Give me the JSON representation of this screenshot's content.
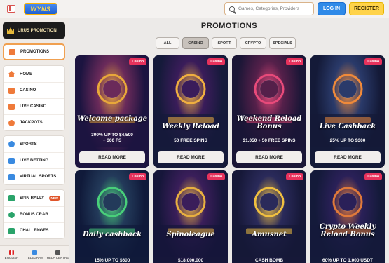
{
  "header": {
    "logo_text": "WYNS",
    "search_placeholder": "Games, Categories, Providers",
    "login_label": "LOG IN",
    "register_label": "REGISTER"
  },
  "sidebar": {
    "promo_banner": "URUS PROMOTION",
    "active_item": "PROMOTIONS",
    "group1": [
      "HOME",
      "CASINO",
      "LIVE CASINO",
      "JACKPOTS"
    ],
    "group2": [
      "SPORTS",
      "LIVE BETTING",
      "VIRTUAL SPORTS"
    ],
    "group3": [
      "SPIN RALLY",
      "BONUS CRAB",
      "CHALLENGES"
    ],
    "new_badge": "NEW",
    "footer": [
      "ENGLISH",
      "TELEGRAM",
      "HELP CENTRE"
    ]
  },
  "main": {
    "title": "PROMOTIONS",
    "tabs": [
      "ALL",
      "CASINO",
      "SPORT",
      "CRYPTO",
      "SPECIALS"
    ],
    "active_tab": "CASINO",
    "read_more_label": "READ MORE",
    "cards": [
      {
        "badge": "Casino",
        "title": "Welcome package",
        "sub": "300% UP TO $4,500\n+ 300 FS",
        "sign": "Bonus"
      },
      {
        "badge": "Casino",
        "title": "Weekly Reload",
        "sub": "50 FREE SPINS",
        "sign": "FREE SPINS"
      },
      {
        "badge": "Casino",
        "title": "Weekend Reload Bonus",
        "sub": "$1,050 + 50 FREE SPINS",
        "sign": ""
      },
      {
        "badge": "Casino",
        "title": "Live Cashback",
        "sub": "25% UP TO $300",
        "sign": "OPEN 24/7"
      },
      {
        "badge": "Casino",
        "title": "Daily cashback",
        "sub": "15% UP TO $600",
        "sign": ""
      },
      {
        "badge": "Casino",
        "title": "Spinoleague",
        "sub": "$18,000,000",
        "sign": "OPEN 24/7"
      },
      {
        "badge": "Casino",
        "title": "Amusnet",
        "sub": "CASH BOMB",
        "sign": "FREE SPINS"
      },
      {
        "badge": "Casino",
        "title": "Crypto Weekly Reload Bonus",
        "sub": "60% UP TO 1,000 USDT",
        "sign": ""
      }
    ]
  }
}
